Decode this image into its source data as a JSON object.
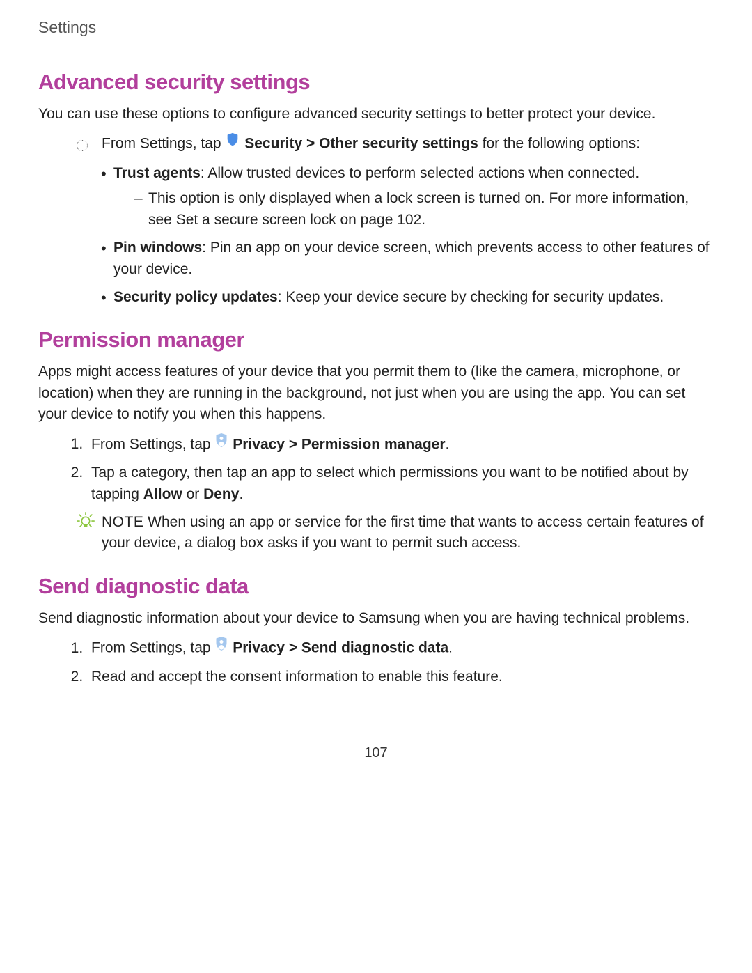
{
  "header": {
    "breadcrumb": "Settings"
  },
  "section1": {
    "heading": "Advanced security settings",
    "intro": "You can use these options to configure advanced security settings to better protect your device.",
    "step_prefix": "From Settings, tap ",
    "step_bold1": "Security",
    "step_sep": " > ",
    "step_bold2": "Other security settings",
    "step_suffix": " for the following options:",
    "bullets": {
      "b1_label": "Trust agents",
      "b1_text": ": Allow trusted devices to perform selected actions when connected.",
      "b1_sub_prefix": "This option is only displayed when a lock screen is turned on. For more information, see ",
      "b1_sub_link": "Set a secure screen lock",
      "b1_sub_suffix": " on page 102.",
      "b2_label": "Pin windows",
      "b2_text": ": Pin an app on your device screen, which prevents access to other features of your device.",
      "b3_label": "Security policy updates",
      "b3_text": ": Keep your device secure by checking for security updates."
    }
  },
  "section2": {
    "heading": "Permission manager",
    "intro": "Apps might access features of your device that you permit them to (like the camera, microphone, or location) when they are running in the background, not just when you are using the app. You can set your device to notify you when this happens.",
    "step1_prefix": "From Settings, tap ",
    "step1_bold1": "Privacy",
    "step1_sep": " > ",
    "step1_bold2": "Permission manager",
    "step1_suffix": ".",
    "step2_prefix": "Tap a category, then tap an app to select which permissions you want to be notified about by tapping ",
    "step2_bold1": "Allow",
    "step2_mid": " or ",
    "step2_bold2": "Deny",
    "step2_suffix": ".",
    "note_label": "NOTE",
    "note_text": "  When using an app or service for the first time that wants to access certain features of your device, a dialog box asks if you want to permit such access."
  },
  "section3": {
    "heading": "Send diagnostic data",
    "intro": "Send diagnostic information about your device to Samsung when you are having technical problems.",
    "step1_prefix": "From Settings, tap ",
    "step1_bold1": "Privacy",
    "step1_sep": " > ",
    "step1_bold2": "Send diagnostic data",
    "step1_suffix": ".",
    "step2": "Read and accept the consent information to enable this feature."
  },
  "page_number": "107"
}
